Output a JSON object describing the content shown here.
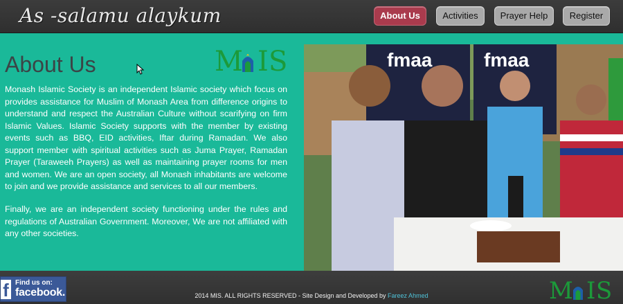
{
  "header": {
    "brand": "As -salamu alaykum",
    "nav": [
      {
        "label": "About Us",
        "active": true
      },
      {
        "label": "Activities",
        "active": false
      },
      {
        "label": "Prayer Help",
        "active": false
      },
      {
        "label": "Register",
        "active": false
      }
    ]
  },
  "main": {
    "title": "About Us",
    "logo_text": "MIS",
    "paragraphs": [
      "Monash Islamic Society is an independent Islamic society which focus on provides assistance for Muslim of Monash Area from difference origins to understand and respect the Australian Culture without scarifying on firm Islamic Values. Islamic Society supports with the member by existing events such as BBQ, EID activities, Iftar during Ramadan. We also support member with spiritual activities such as Juma Prayer, Ramadan Prayer (Taraweeh Prayers) as well as maintaining prayer rooms for men and women. We are an open society, all Monash inhabitants are welcome to join and we provide assistance and services to all our members.",
      "Finally, we are an independent society functioning under the rules and regulations of Australian Government. Moreover, We are not affiliated with any other societies."
    ],
    "photo_banner_text": [
      "fmaa",
      "fmaa"
    ]
  },
  "footer": {
    "facebook_small": "Find us on:",
    "facebook_big": "facebook.",
    "copyright": "2014 MIS. ALL RIGHTS RESERVED - Site Design and Developed by ",
    "developer": "Fareez Ahmed",
    "logo_text": "MIS"
  },
  "colors": {
    "background": "#1ab999",
    "active_nav": "#a93b4d",
    "logo_green": "#1c9a3a",
    "logo_blue": "#1d5fa8"
  }
}
